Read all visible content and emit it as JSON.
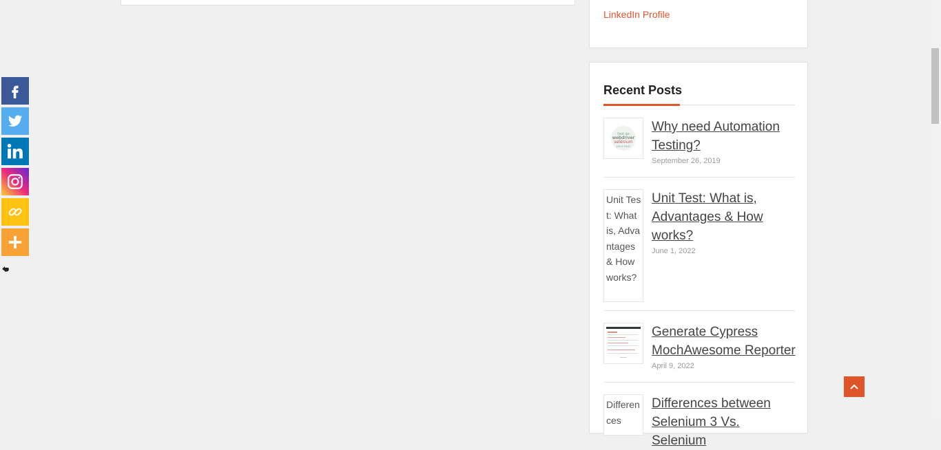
{
  "widget_top": {
    "linkedin_label": "LinkedIn Profile"
  },
  "recent_posts": {
    "title": "Recent Posts",
    "posts": [
      {
        "title": "Why need Automation Testing?",
        "date": "September 26, 2019",
        "thumb_alt": ""
      },
      {
        "title": "Unit Test: What is, Advantages & How works?",
        "date": "June 1, 2022",
        "thumb_alt": "Unit Test: What is, Advantages & How works?"
      },
      {
        "title": "Generate Cypress MochAwesome Reporter",
        "date": "April 9, 2022",
        "thumb_alt": ""
      },
      {
        "title": "Differences between Selenium 3 Vs. Selenium",
        "date": "",
        "thumb_alt": "Differences"
      }
    ]
  },
  "share_bar": {
    "items": [
      {
        "name": "facebook",
        "color": "#3b5998"
      },
      {
        "name": "twitter",
        "color": "#55acee"
      },
      {
        "name": "linkedin",
        "color": "#0077b5"
      },
      {
        "name": "instagram",
        "color": "#c13584"
      },
      {
        "name": "copy-link",
        "color": "#ffc112"
      },
      {
        "name": "more",
        "color": "#f8a236"
      }
    ]
  },
  "colors": {
    "accent": "#e0542a",
    "background": "#f0f0f0"
  }
}
